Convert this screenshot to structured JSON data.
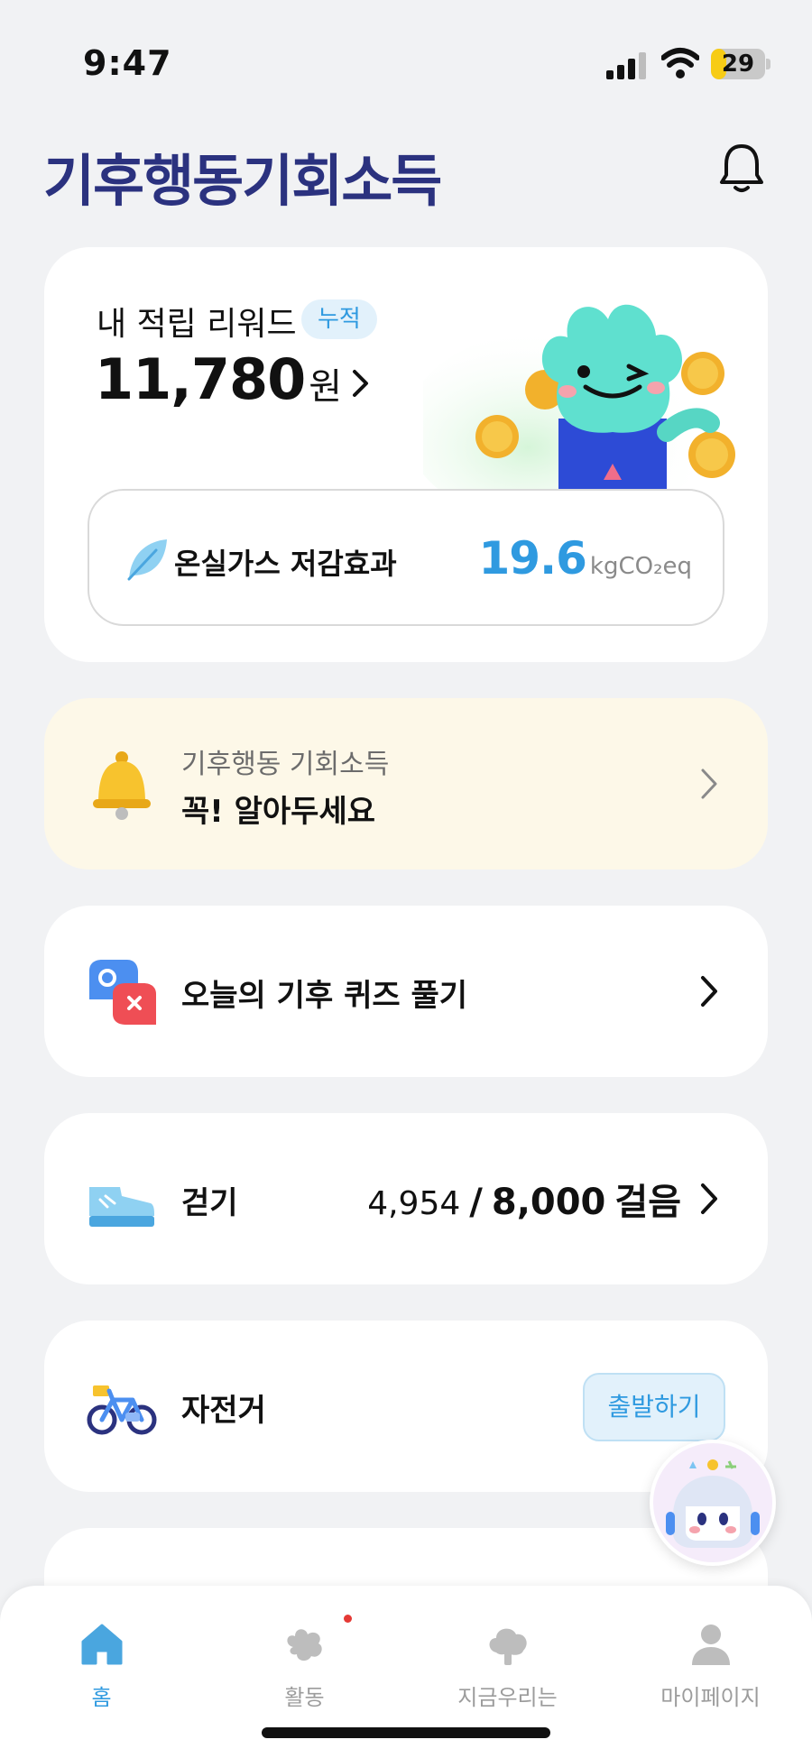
{
  "status_bar": {
    "time": "9:47",
    "battery": "29",
    "battery_level": 0.29
  },
  "header": {
    "logo_text": "기후행동기회소득"
  },
  "reward": {
    "title": "내 적립 리워드",
    "badge": "누적",
    "amount": "11,780",
    "unit": "원",
    "ghg_label": "온실가스 저감효과",
    "ghg_value": "19.6",
    "ghg_unit": "kgCO₂eq"
  },
  "notice": {
    "subtitle": "기후행동 기회소득",
    "title": "꼭! 알아두세요"
  },
  "quiz": {
    "label": "오늘의 기후 퀴즈 풀기"
  },
  "walk": {
    "label": "걷기",
    "current": "4,954",
    "separator": "/",
    "goal": "8,000",
    "unit": "걸음"
  },
  "bike": {
    "label": "자전거",
    "button": "출발하기"
  },
  "tabs": [
    {
      "label": "홈",
      "icon": "home-icon",
      "active": true
    },
    {
      "label": "활동",
      "icon": "activity-icon",
      "active": false
    },
    {
      "label": "지금우리는",
      "icon": "tree-icon",
      "active": false
    },
    {
      "label": "마이페이지",
      "icon": "person-icon",
      "active": false
    }
  ],
  "colors": {
    "accent": "#2f9ae0",
    "logo": "#2b327f",
    "notice_bg": "#fdf8e8",
    "background": "#f1f2f4"
  }
}
